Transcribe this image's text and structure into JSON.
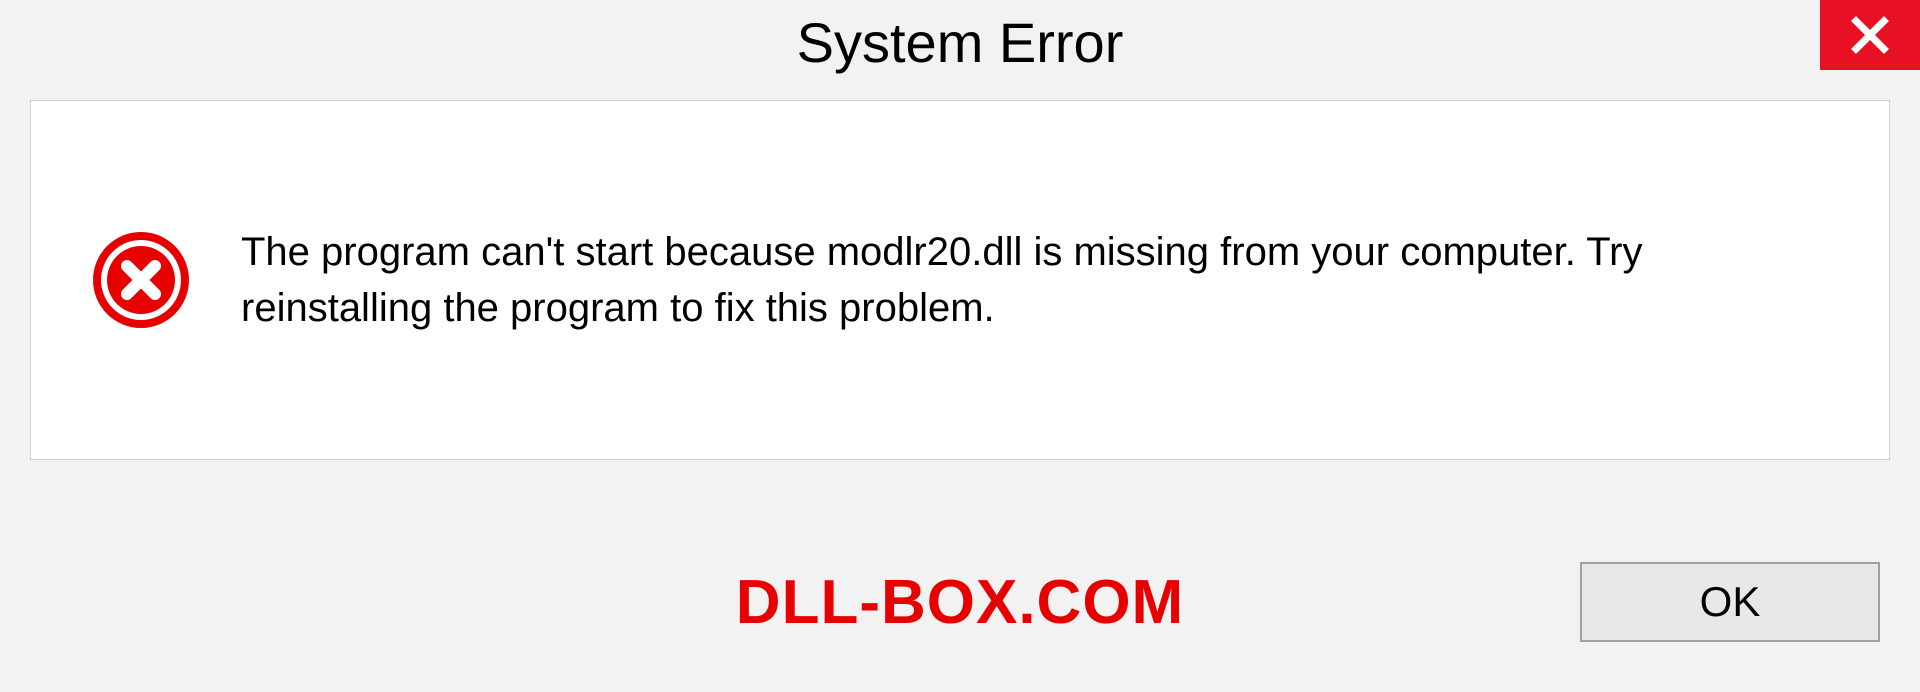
{
  "titlebar": {
    "title": "System Error"
  },
  "message": {
    "text": "The program can't start because modlr20.dll is missing from your computer. Try reinstalling the program to fix this problem."
  },
  "footer": {
    "watermark": "DLL-BOX.COM",
    "ok_label": "OK"
  },
  "colors": {
    "close_red": "#e81123",
    "error_red": "#e60000",
    "panel_bg": "#ffffff",
    "body_bg": "#f2f2f2"
  }
}
